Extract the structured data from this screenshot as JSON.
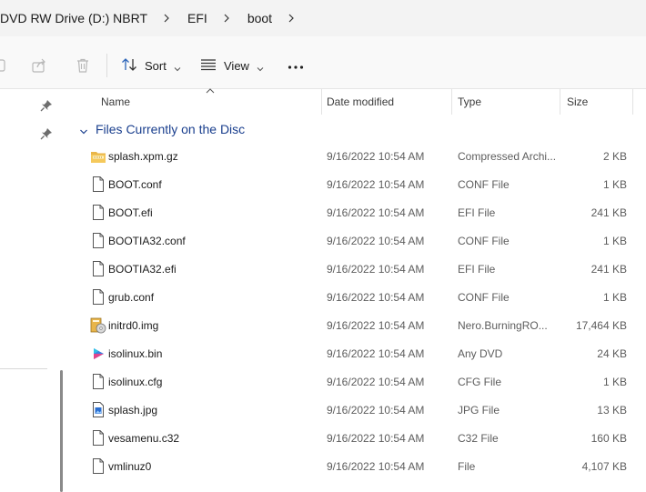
{
  "breadcrumb": {
    "items": [
      "DVD RW Drive (D:) NBRT",
      "EFI",
      "boot"
    ]
  },
  "toolbar": {
    "sort_label": "Sort",
    "view_label": "View",
    "more_label": "•••"
  },
  "columns": {
    "name": "Name",
    "date": "Date modified",
    "type": "Type",
    "size": "Size"
  },
  "group": {
    "title": "Files Currently on the Disc"
  },
  "files": [
    {
      "name": "splash.xpm.gz",
      "date": "9/16/2022 10:54 AM",
      "type": "Compressed Archi...",
      "size": "2 KB",
      "icon": "archive-icon"
    },
    {
      "name": "BOOT.conf",
      "date": "9/16/2022 10:54 AM",
      "type": "CONF File",
      "size": "1 KB",
      "icon": "file-icon"
    },
    {
      "name": "BOOT.efi",
      "date": "9/16/2022 10:54 AM",
      "type": "EFI File",
      "size": "241 KB",
      "icon": "file-icon"
    },
    {
      "name": "BOOTIA32.conf",
      "date": "9/16/2022 10:54 AM",
      "type": "CONF File",
      "size": "1 KB",
      "icon": "file-icon"
    },
    {
      "name": "BOOTIA32.efi",
      "date": "9/16/2022 10:54 AM",
      "type": "EFI File",
      "size": "241 KB",
      "icon": "file-icon"
    },
    {
      "name": "grub.conf",
      "date": "9/16/2022 10:54 AM",
      "type": "CONF File",
      "size": "1 KB",
      "icon": "file-icon"
    },
    {
      "name": "initrd0.img",
      "date": "9/16/2022 10:54 AM",
      "type": "Nero.BurningRO...",
      "size": "17,464 KB",
      "icon": "disc-image-icon"
    },
    {
      "name": "isolinux.bin",
      "date": "9/16/2022 10:54 AM",
      "type": "Any DVD",
      "size": "24 KB",
      "icon": "media-player-icon"
    },
    {
      "name": "isolinux.cfg",
      "date": "9/16/2022 10:54 AM",
      "type": "CFG File",
      "size": "1 KB",
      "icon": "file-icon"
    },
    {
      "name": "splash.jpg",
      "date": "9/16/2022 10:54 AM",
      "type": "JPG File",
      "size": "13 KB",
      "icon": "image-file-icon"
    },
    {
      "name": "vesamenu.c32",
      "date": "9/16/2022 10:54 AM",
      "type": "C32 File",
      "size": "160 KB",
      "icon": "file-icon"
    },
    {
      "name": "vmlinuz0",
      "date": "9/16/2022 10:54 AM",
      "type": "File",
      "size": "4,107 KB",
      "icon": "file-icon"
    }
  ]
}
